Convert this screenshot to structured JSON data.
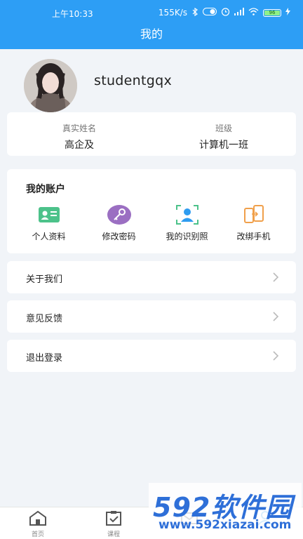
{
  "status_bar": {
    "time": "上午10:33",
    "net_speed": "155K/s",
    "battery_level": "96"
  },
  "header": {
    "title": "我的"
  },
  "profile": {
    "username": "studentgqx"
  },
  "info": {
    "name_label": "真实姓名",
    "name_value": "高企及",
    "class_label": "班级",
    "class_value": "计算机一班"
  },
  "account": {
    "title": "我的账户",
    "items": [
      {
        "label": "个人资料",
        "icon": "id-card-icon",
        "color": "#4cc28a"
      },
      {
        "label": "修改密码",
        "icon": "key-icon",
        "color": "#9b6fc2"
      },
      {
        "label": "我的识别照",
        "icon": "face-scan-icon",
        "color": "#2e9cf0"
      },
      {
        "label": "改绑手机",
        "icon": "phone-switch-icon",
        "color": "#f0a04b"
      }
    ]
  },
  "menu": {
    "about": "关于我们",
    "feedback": "意见反馈",
    "logout": "退出登录"
  },
  "tabbar": {
    "items": [
      {
        "label": "首页",
        "icon": "home-icon"
      },
      {
        "label": "课程",
        "icon": "clipboard-check-icon"
      },
      {
        "label": "",
        "icon": "mail-icon"
      },
      {
        "label": "",
        "icon": "user-icon"
      }
    ]
  },
  "watermark": {
    "brand": "592软件园",
    "url": "www.592xiazai.com"
  }
}
